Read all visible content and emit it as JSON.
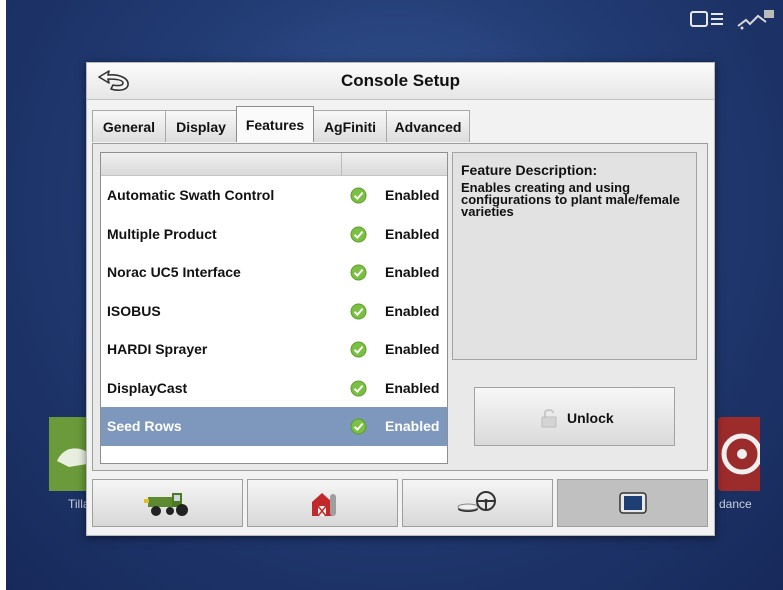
{
  "dialog": {
    "title": "Console Setup",
    "back_icon": "back-arrow-icon"
  },
  "tabs": [
    {
      "label": "General",
      "active": false
    },
    {
      "label": "Display",
      "active": false
    },
    {
      "label": "Features",
      "active": true
    },
    {
      "label": "AgFiniti",
      "active": false
    },
    {
      "label": "Advanced",
      "active": false
    }
  ],
  "features": [
    {
      "name": "Automatic Swath Control",
      "status": "Enabled",
      "selected": false
    },
    {
      "name": "Multiple Product",
      "status": "Enabled",
      "selected": false
    },
    {
      "name": "Norac UC5 Interface",
      "status": "Enabled",
      "selected": false
    },
    {
      "name": "ISOBUS",
      "status": "Enabled",
      "selected": false
    },
    {
      "name": "HARDI Sprayer",
      "status": "Enabled",
      "selected": false
    },
    {
      "name": "DisplayCast",
      "status": "Enabled",
      "selected": false
    },
    {
      "name": "Seed Rows",
      "status": "Enabled",
      "selected": true
    }
  ],
  "description": {
    "title": "Feature Description:",
    "text": "Enables creating and using configurations to plant male/female varieties"
  },
  "unlock": {
    "label": "Unlock",
    "icon": "lock-icon"
  },
  "bottom_bar": [
    {
      "icon": "tractor-icon",
      "active": false
    },
    {
      "icon": "farm-barn-icon",
      "active": false
    },
    {
      "icon": "guidance-steering-icon",
      "active": false
    },
    {
      "icon": "display-console-icon",
      "active": true
    }
  ],
  "background_tiles": {
    "left_label": "Tilla",
    "right_label": "dance"
  },
  "status_icons": [
    "vehicle-icon",
    "gps-satellite-icon"
  ],
  "colors": {
    "selected_row": "#7e98bd",
    "check_green": "#7bc043",
    "screen_bg": "#223c74"
  }
}
